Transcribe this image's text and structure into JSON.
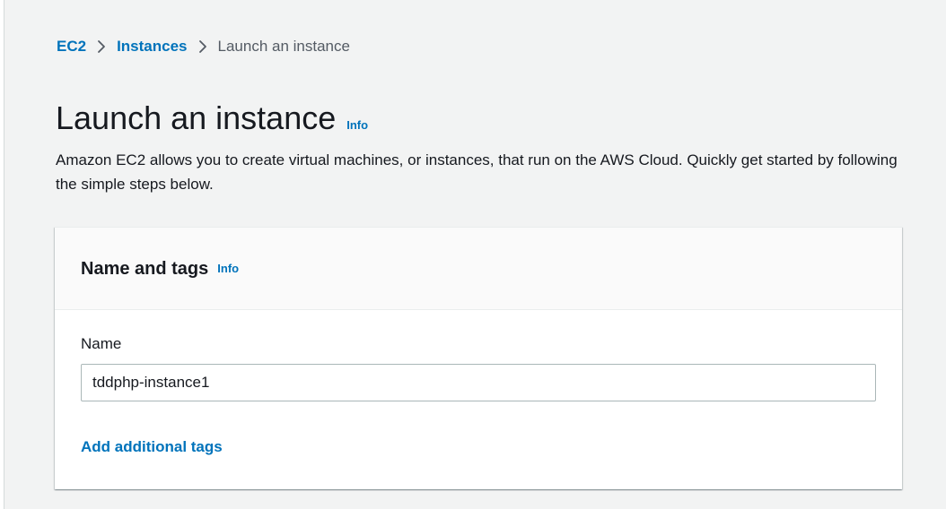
{
  "breadcrumb": {
    "items": [
      {
        "label": "EC2"
      },
      {
        "label": "Instances"
      },
      {
        "label": "Launch an instance"
      }
    ]
  },
  "header": {
    "title": "Launch an instance",
    "info_label": "Info",
    "description": "Amazon EC2 allows you to create virtual machines, or instances, that run on the AWS Cloud. Quickly get started by following the simple steps below."
  },
  "name_and_tags": {
    "title": "Name and tags",
    "info_label": "Info",
    "name_label": "Name",
    "name_value": "tddphp-instance1",
    "add_tags_label": "Add additional tags"
  },
  "colors": {
    "link": "#0073bb",
    "text": "#16191f",
    "background": "#f2f3f3",
    "panel_header": "#fafafa"
  },
  "icons": {
    "separator": "chevron-right-icon"
  }
}
